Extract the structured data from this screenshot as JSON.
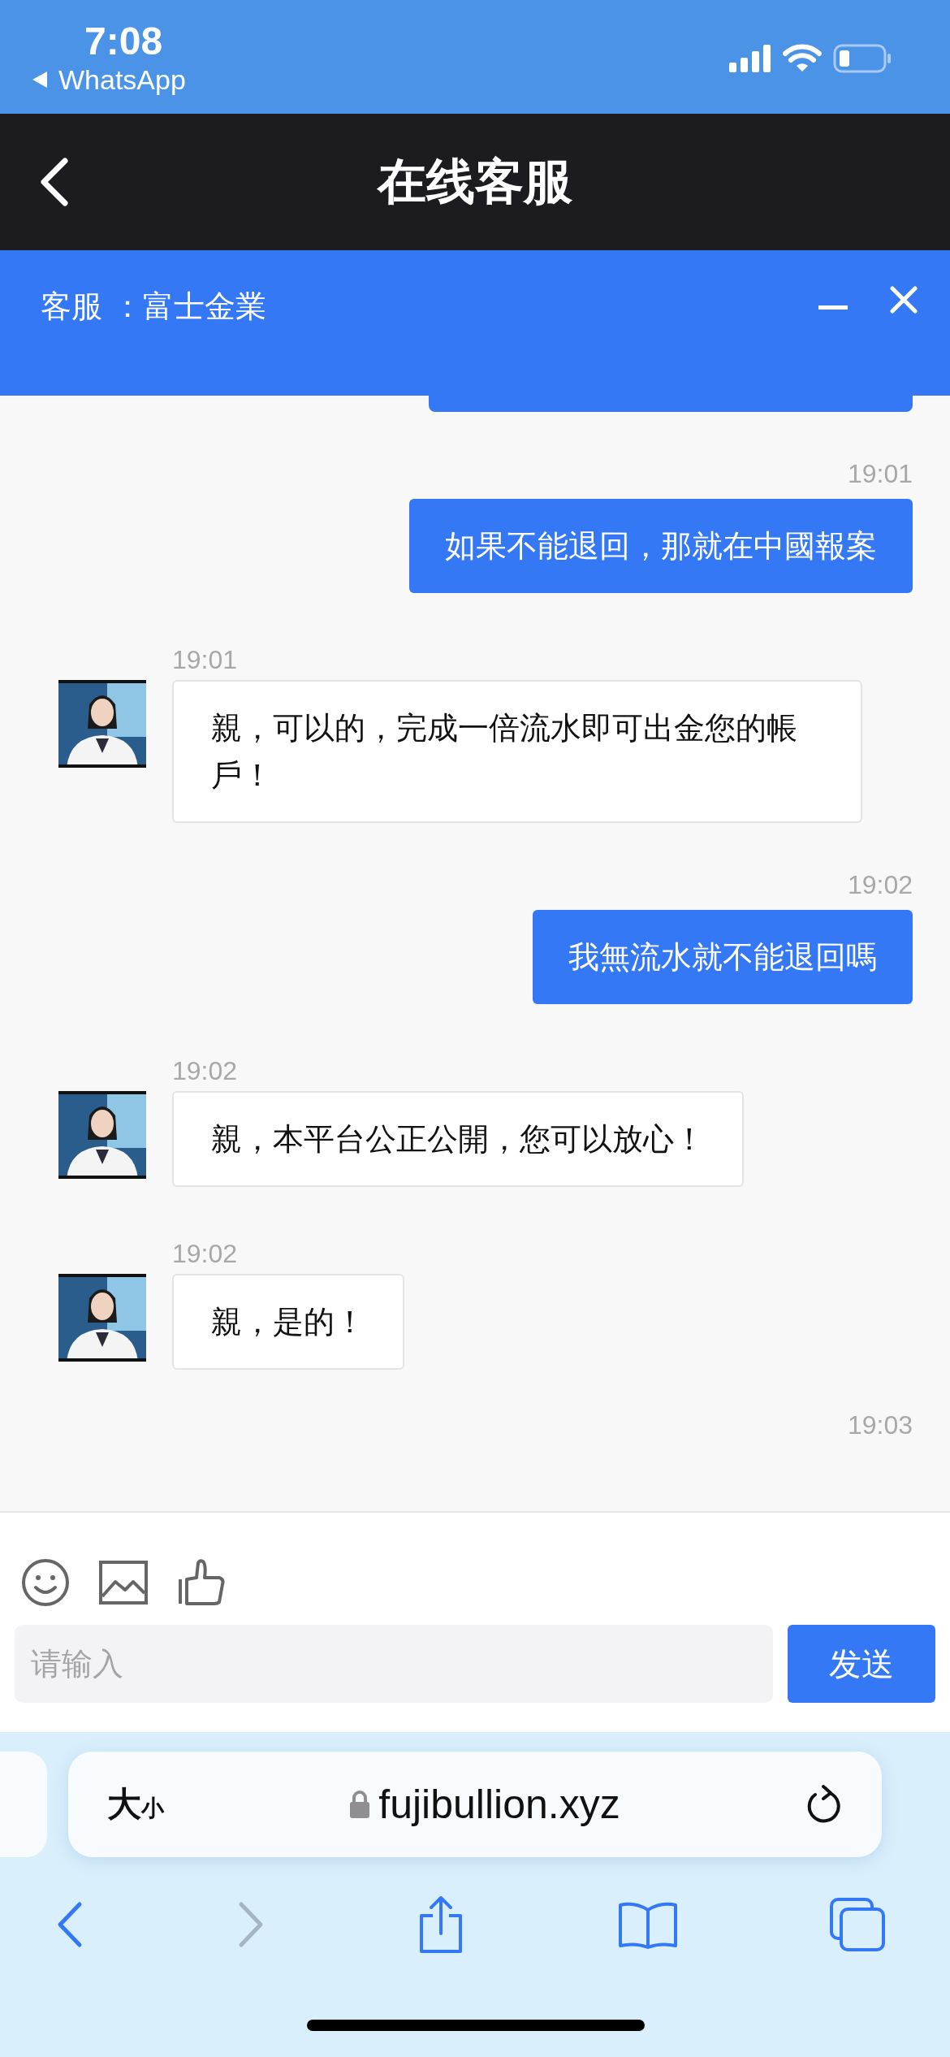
{
  "status_bar": {
    "time": "7:08",
    "back_app": "WhatsApp"
  },
  "nav_bar": {
    "title": "在线客服"
  },
  "chat_header": {
    "title": "客服 ：富士金業"
  },
  "messages": [
    {
      "kind": "user",
      "cut_off": true
    },
    {
      "kind": "user",
      "time": "19:01",
      "text": "如果不能退回，那就在中國報案"
    },
    {
      "kind": "agent",
      "time": "19:01",
      "text": "親，可以的，完成一倍流水即可出金您的帳戶！"
    },
    {
      "kind": "user",
      "time": "19:02",
      "text": "我無流水就不能退回嗎"
    },
    {
      "kind": "agent",
      "time": "19:02",
      "text": "親，本平台公正公開，您可以放心！"
    },
    {
      "kind": "agent",
      "time": "19:02",
      "text": "親，是的！"
    },
    {
      "kind": "time",
      "time": "19:03"
    }
  ],
  "composer": {
    "placeholder": "请输入",
    "send": "发送"
  },
  "browser": {
    "size_large": "大",
    "size_small": "小",
    "url": "fujibullion.xyz"
  }
}
